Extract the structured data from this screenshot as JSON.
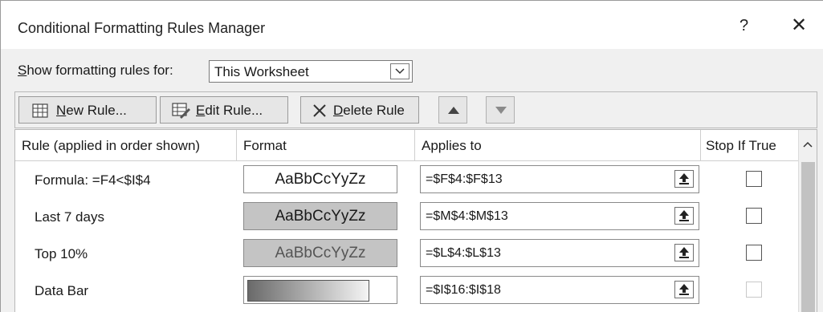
{
  "window": {
    "title": "Conditional Formatting Rules Manager",
    "help": "?",
    "close": "✕"
  },
  "show_rules": {
    "label_accel": "S",
    "label_rest": "how formatting rules for:",
    "selected": "This Worksheet"
  },
  "toolbar": {
    "new_accel": "N",
    "new_rest": "ew Rule...",
    "edit_accel": "E",
    "edit_rest": "dit Rule...",
    "delete_accel": "D",
    "delete_rest": "elete Rule"
  },
  "columns": [
    "Rule (applied in order shown)",
    "Format",
    "Applies to",
    "Stop If True"
  ],
  "rules": [
    {
      "name": "Formula: =F4<$I$4",
      "format_sample": "AaBbCcYyZz",
      "applies_to": "=$F$4:$F$13",
      "stop_if_true": false
    },
    {
      "name": "Last 7 days",
      "format_sample": "AaBbCcYyZz",
      "applies_to": "=$M$4:$M$13",
      "stop_if_true": false
    },
    {
      "name": "Top 10%",
      "format_sample": "AaBbCcYyZz",
      "applies_to": "=$L$4:$L$13",
      "stop_if_true": false
    },
    {
      "name": "Data Bar",
      "format_sample": "",
      "applies_to": "=$I$16:$I$18",
      "stop_if_true": false
    }
  ],
  "colors": {
    "format_fill": "#c4c4c4",
    "data_bar_start": "#6a6a6a",
    "data_bar_end": "#f4f4f4"
  }
}
